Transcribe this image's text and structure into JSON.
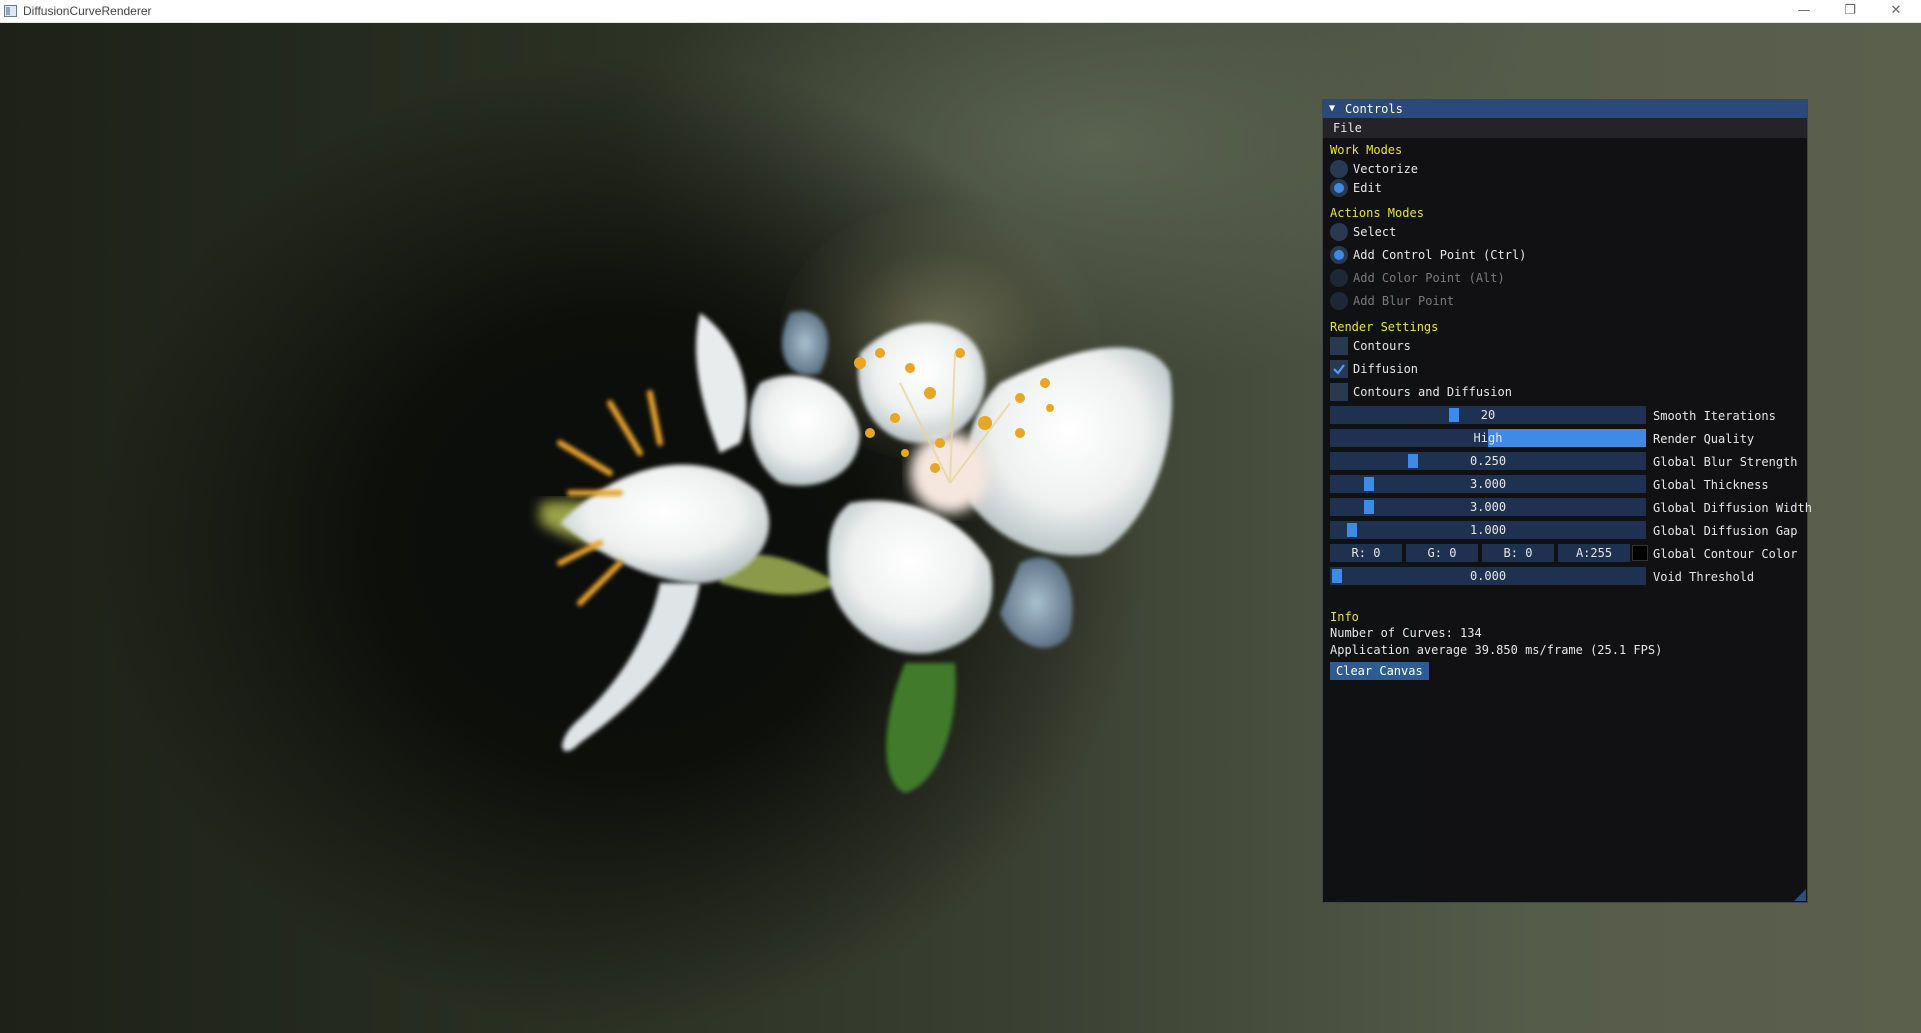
{
  "window": {
    "title": "DiffusionCurveRenderer"
  },
  "controls": {
    "title": "Controls",
    "menu": [
      "File"
    ],
    "work_modes": {
      "heading": "Work Modes",
      "options": [
        {
          "label": "Vectorize",
          "selected": false
        },
        {
          "label": "Edit",
          "selected": true
        }
      ]
    },
    "action_modes": {
      "heading": "Actions Modes",
      "options": [
        {
          "label": "Select",
          "selected": false,
          "enabled": true
        },
        {
          "label": "Add Control Point (Ctrl)",
          "selected": true,
          "enabled": true
        },
        {
          "label": "Add Color Point (Alt)",
          "selected": false,
          "enabled": false
        },
        {
          "label": "Add Blur Point",
          "selected": false,
          "enabled": false
        }
      ]
    },
    "render_settings": {
      "heading": "Render Settings",
      "checkboxes": [
        {
          "label": "Contours",
          "checked": false
        },
        {
          "label": "Diffusion",
          "checked": true
        },
        {
          "label": "Contours and Diffusion",
          "checked": false
        }
      ],
      "sliders": [
        {
          "label": "Smooth Iterations",
          "value": "20",
          "level": 0.38
        },
        {
          "label": "Render Quality",
          "value": "High",
          "level": 0.5,
          "type": "combo"
        },
        {
          "label": "Global Blur Strength",
          "value": "0.250",
          "level": 0.25
        },
        {
          "label": "Global Thickness",
          "value": "3.000",
          "level": 0.1
        },
        {
          "label": "Global Diffusion Width",
          "value": "3.000",
          "level": 0.1
        },
        {
          "label": "Global Diffusion Gap",
          "value": "1.000",
          "level": 0.05
        }
      ],
      "contour_color": {
        "label": "Global Contour Color",
        "r": "R: 0",
        "g": "G: 0",
        "b": "B: 0",
        "a": "A:255",
        "swatch": "#000000"
      },
      "void_threshold": {
        "label": "Void Threshold",
        "value": "0.000",
        "level": 0.0
      }
    },
    "info": {
      "heading": "Info",
      "curves": "Number of Curves: 134",
      "perf": "Application average 39.850 ms/frame (25.1 FPS)"
    },
    "clear_button": "Clear Canvas"
  },
  "colors": {
    "accent": "#3f8ae6",
    "frame": "#1f3150",
    "title_bg": "#294a7a",
    "section": "#e8e231"
  }
}
